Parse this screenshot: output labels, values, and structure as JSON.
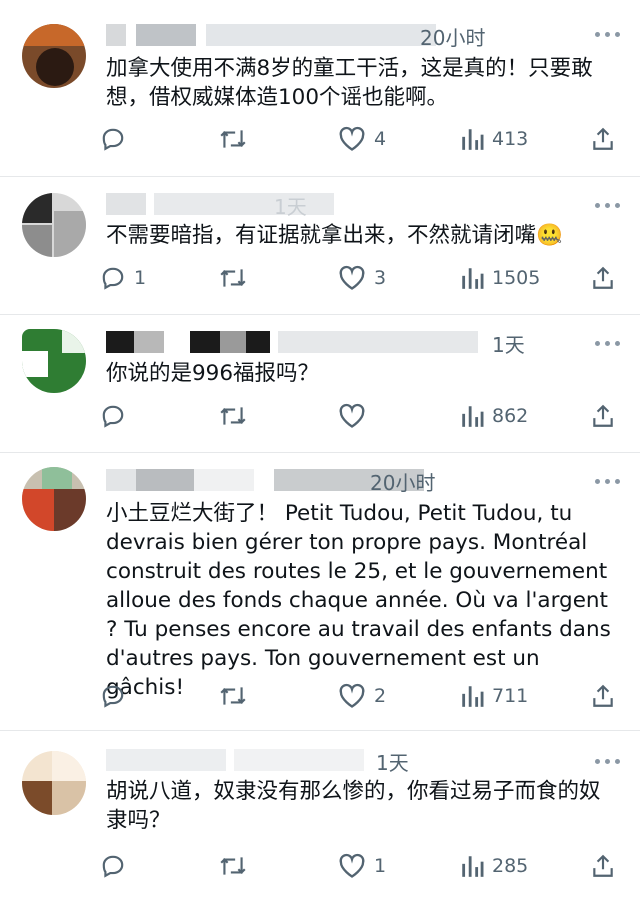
{
  "tweets": [
    {
      "time": "20小时",
      "text": "加拿大使用不满8岁的童工干活，这是真的！只要敢想，借权威媒体造100个谣也能啊。",
      "reply_count": "",
      "like_count": "4",
      "view_count": "413"
    },
    {
      "time": "1天",
      "text": "不需要暗指，有证据就拿出来，不然就请闭嘴🤐",
      "reply_count": "1",
      "like_count": "3",
      "view_count": "1505"
    },
    {
      "time": "1天",
      "text": "你说的是996福报吗？",
      "reply_count": "",
      "like_count": "",
      "view_count": "862"
    },
    {
      "time": "20小时",
      "text": "小土豆烂大街了！ Petit Tudou, Petit Tudou, tu devrais bien gérer ton propre pays. Montréal construit des routes le 25, et le gouvernement alloue des fonds chaque année. Où va l'argent ? Tu penses encore au travail des enfants dans d'autres pays. Ton gouvernement est un gâchis!",
      "reply_count": "",
      "like_count": "2",
      "view_count": "711"
    },
    {
      "time": "1天",
      "text": "胡说八道，奴隶没有那么惨的，你看过易子而食的奴隶吗？",
      "reply_count": "",
      "like_count": "1",
      "view_count": "285"
    }
  ],
  "colors": {
    "icon": "#536471",
    "text": "#0f1419",
    "divider": "#e6e8ea"
  },
  "icons": [
    "reply-icon",
    "retweet-icon",
    "like-icon",
    "views-icon",
    "share-icon",
    "more-icon"
  ]
}
